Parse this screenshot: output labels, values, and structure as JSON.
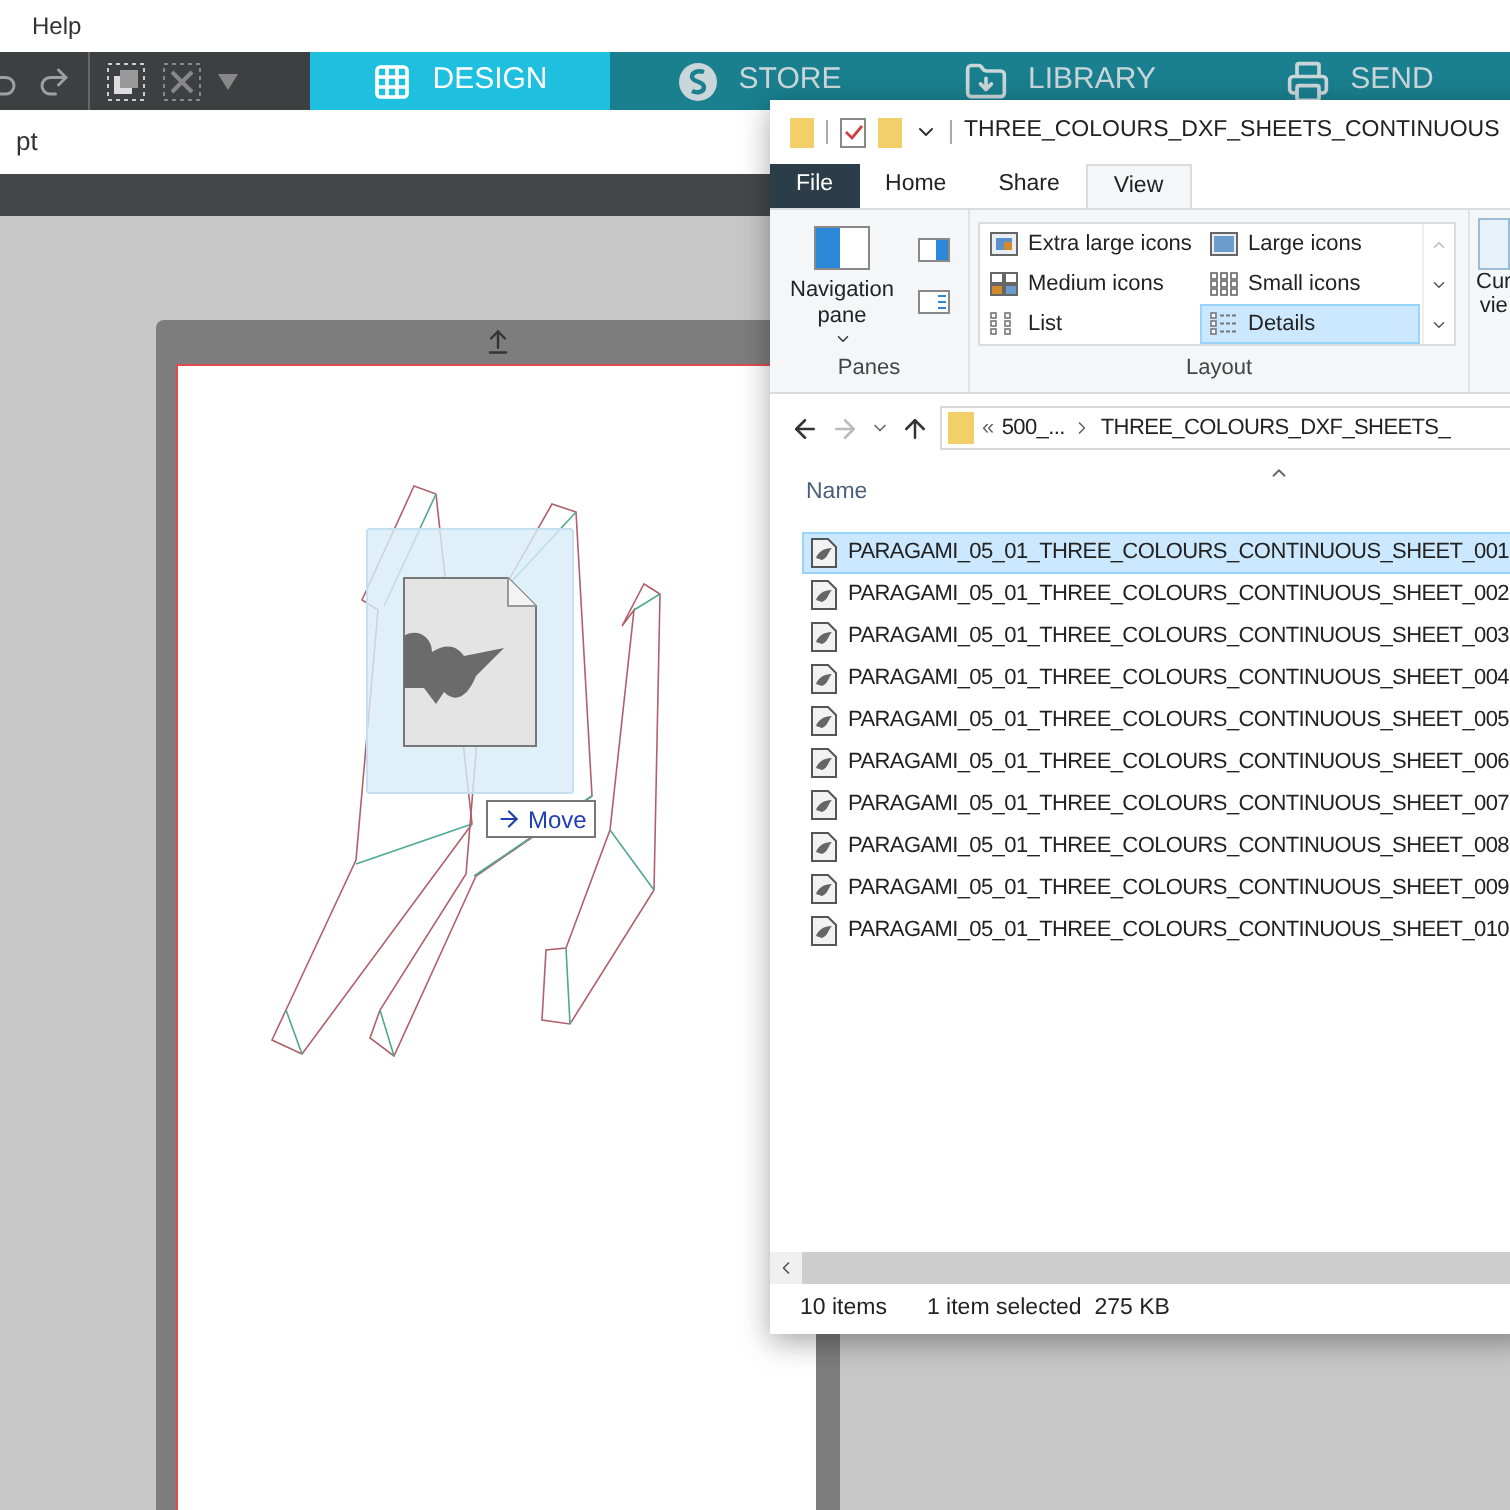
{
  "menu": [
    "Help"
  ],
  "toolbar_tabs": [
    {
      "label": "DESIGN",
      "kind": "design",
      "selected": true
    },
    {
      "label": "STORE",
      "kind": "store",
      "selected": false
    },
    {
      "label": "LIBRARY",
      "kind": "library",
      "selected": false
    },
    {
      "label": "SEND",
      "kind": "send",
      "selected": false
    }
  ],
  "units": "pt",
  "drag": {
    "action": "Move"
  },
  "explorer": {
    "title": "THREE_COLOURS_DXF_SHEETS_CONTINUOUS",
    "ribbon_tabs": [
      {
        "label": "File",
        "kind": "file",
        "selected": false
      },
      {
        "label": "Home",
        "kind": "tab",
        "selected": false
      },
      {
        "label": "Share",
        "kind": "tab",
        "selected": false
      },
      {
        "label": "View",
        "kind": "tab",
        "selected": true
      }
    ],
    "panes": {
      "button": "Navigation pane",
      "group": "Panes"
    },
    "layout": {
      "group": "Layout",
      "options": [
        {
          "label": "Extra large icons",
          "kind": "xl",
          "selected": false
        },
        {
          "label": "Large icons",
          "kind": "large",
          "selected": false
        },
        {
          "label": "Medium icons",
          "kind": "medium",
          "selected": false
        },
        {
          "label": "Small icons",
          "kind": "small",
          "selected": false
        },
        {
          "label": "List",
          "kind": "list",
          "selected": false
        },
        {
          "label": "Details",
          "kind": "details",
          "selected": true
        }
      ]
    },
    "current_view": [
      "Cur",
      "vie"
    ],
    "breadcrumb": {
      "overflow": "«",
      "parts": [
        "500_...",
        "THREE_COLOURS_DXF_SHEETS_"
      ]
    },
    "column": "Name",
    "files": [
      {
        "name": "PARAGAMI_05_01_THREE_COLOURS_CONTINUOUS_SHEET_001",
        "selected": true
      },
      {
        "name": "PARAGAMI_05_01_THREE_COLOURS_CONTINUOUS_SHEET_002",
        "selected": false
      },
      {
        "name": "PARAGAMI_05_01_THREE_COLOURS_CONTINUOUS_SHEET_003",
        "selected": false
      },
      {
        "name": "PARAGAMI_05_01_THREE_COLOURS_CONTINUOUS_SHEET_004",
        "selected": false
      },
      {
        "name": "PARAGAMI_05_01_THREE_COLOURS_CONTINUOUS_SHEET_005",
        "selected": false
      },
      {
        "name": "PARAGAMI_05_01_THREE_COLOURS_CONTINUOUS_SHEET_006",
        "selected": false
      },
      {
        "name": "PARAGAMI_05_01_THREE_COLOURS_CONTINUOUS_SHEET_007",
        "selected": false
      },
      {
        "name": "PARAGAMI_05_01_THREE_COLOURS_CONTINUOUS_SHEET_008",
        "selected": false
      },
      {
        "name": "PARAGAMI_05_01_THREE_COLOURS_CONTINUOUS_SHEET_009",
        "selected": false
      },
      {
        "name": "PARAGAMI_05_01_THREE_COLOURS_CONTINUOUS_SHEET_010",
        "selected": false
      }
    ],
    "status": {
      "count": "10 items",
      "selection": "1 item selected  275 KB"
    }
  }
}
